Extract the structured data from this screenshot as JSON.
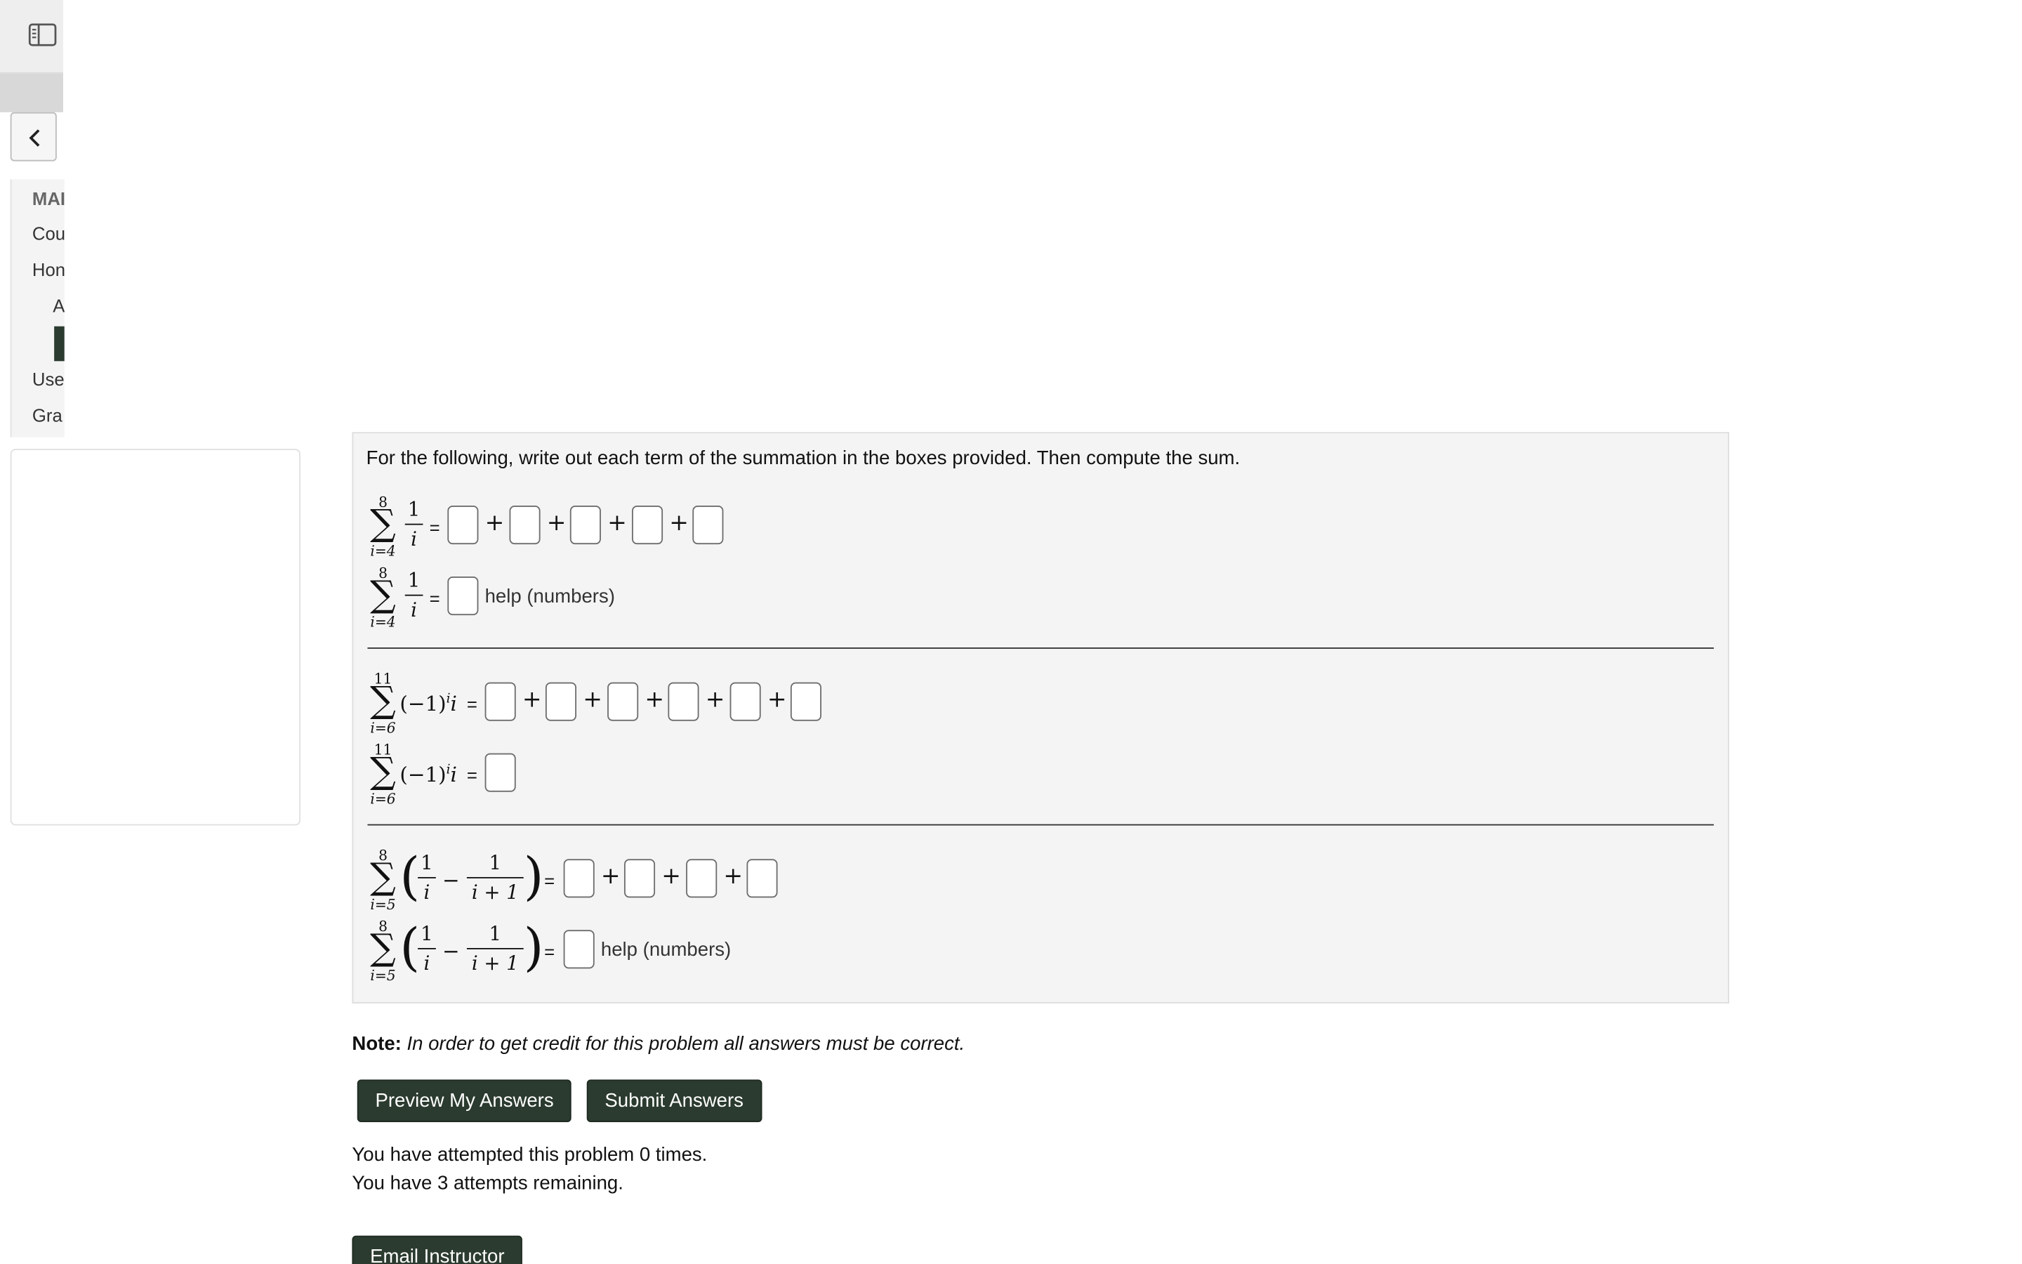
{
  "sidebar": {
    "heading": "MAI",
    "items": [
      {
        "label": "Cou"
      },
      {
        "label": "Hon"
      },
      {
        "label": "A"
      },
      {
        "label": "Use"
      },
      {
        "label": "Gra"
      }
    ]
  },
  "problem": {
    "prompt": "For the following, write out each term of the summation in the boxes provided. Then compute the sum.",
    "part1": {
      "upper": "8",
      "lower": "i=4",
      "numerator": "1",
      "denominator": "i",
      "equals": "=",
      "help_text": "help (numbers)"
    },
    "part2": {
      "upper": "11",
      "lower": "i=6",
      "expression_base": "(−1)",
      "expression_exp": "i",
      "expression_tail": "i",
      "equals": "="
    },
    "part3": {
      "upper": "8",
      "lower": "i=5",
      "frac1_num": "1",
      "frac1_den": "i",
      "minus": "−",
      "frac2_num": "1",
      "frac2_den": "i + 1",
      "equals": "=",
      "help_text": "help (numbers)"
    },
    "plus": "+"
  },
  "note": {
    "label": "Note:",
    "text": "In order to get credit for this problem all answers must be correct."
  },
  "buttons": {
    "preview": "Preview My Answers",
    "submit": "Submit Answers",
    "email": "Email Instructor"
  },
  "attempts": {
    "line1": "You have attempted this problem 0 times.",
    "line2": "You have 3 attempts remaining."
  },
  "colors": {
    "button_bg": "#2b3b2f",
    "problem_bg": "#f4f4f4"
  }
}
